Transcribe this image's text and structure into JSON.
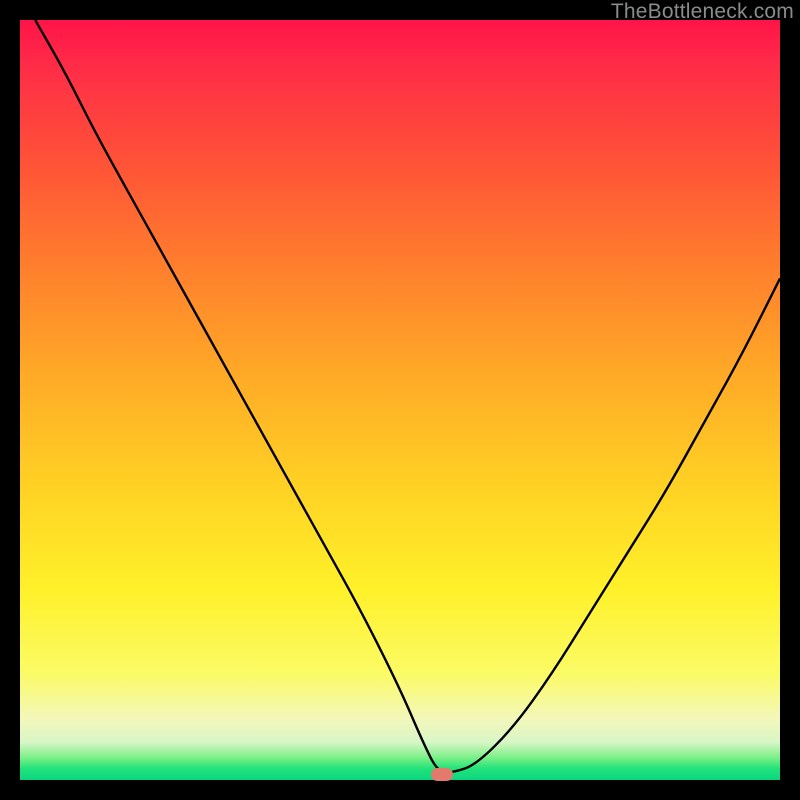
{
  "watermark": "TheBottleneck.com",
  "marker": {
    "x_frac": 0.555,
    "y_frac": 0.992
  },
  "chart_data": {
    "type": "line",
    "title": "",
    "xlabel": "",
    "ylabel": "",
    "xlim": [
      0,
      100
    ],
    "ylim": [
      0,
      100
    ],
    "series": [
      {
        "name": "bottleneck-curve",
        "x": [
          2,
          6,
          10,
          15,
          20,
          25,
          30,
          35,
          40,
          45,
          50,
          53,
          55,
          57,
          60,
          65,
          70,
          75,
          80,
          85,
          90,
          95,
          100
        ],
        "y": [
          100,
          93,
          85,
          76,
          67,
          58,
          49,
          40,
          31,
          22,
          12,
          5,
          1,
          1,
          2,
          7,
          14,
          22,
          30,
          38,
          47,
          56,
          66
        ]
      }
    ],
    "annotations": [
      {
        "type": "marker",
        "x": 55.5,
        "y": 0.8,
        "label": "optimal-point"
      }
    ],
    "background_gradient": {
      "orientation": "vertical",
      "stops": [
        {
          "pos": 0.0,
          "color": "#ff1449"
        },
        {
          "pos": 0.18,
          "color": "#ff5038"
        },
        {
          "pos": 0.46,
          "color": "#ffa827"
        },
        {
          "pos": 0.75,
          "color": "#fff12a"
        },
        {
          "pos": 0.92,
          "color": "#f3f7bb"
        },
        {
          "pos": 1.0,
          "color": "#0ad681"
        }
      ]
    }
  }
}
